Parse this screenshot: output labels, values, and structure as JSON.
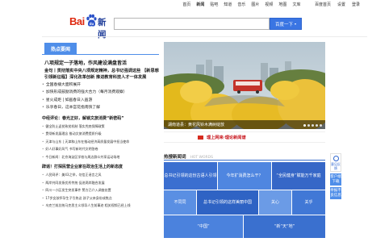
{
  "topnav": {
    "items": [
      "首页",
      "新闻",
      "贴吧",
      "知道",
      "音乐",
      "图片",
      "视频",
      "地图",
      "文库"
    ],
    "active_index": 1,
    "right": [
      "百度首页",
      "设置",
      "登录"
    ]
  },
  "header": {
    "logo_text_left": "Bai",
    "logo_paw_text": "du",
    "logo_text_right": "新闻",
    "search_placeholder": "",
    "search_button": "百度一下",
    "search_caret": "▾"
  },
  "hot_news": {
    "tab_label": "热点要闻",
    "headline_1": "八项规定一子落地，作风建设满盘皆活",
    "headline_2": "金句丨贯彻落实中央八项规定精神，总书记强调这些 【新思想引领新征程】深化改革创新 推进教育科技人才一体发展",
    "items": [
      "全国春播大面积展开",
      "加快形成鼓励消费的强大合力（每月消费观察）",
      "星火成炬 | 如画春日入画游",
      "乐享春日，这本宫花指南快了解"
    ],
    "sub_headline": "中经评论：春光正好，解锁文旅消费“新密码”",
    "sub_items": [
      "健全防止返贫致贫机制 落实兜底保障政策",
      "贯彻新发展理念 推动文旅消费提质升级",
      "天津与山东 | 天津和山东在推动经济高质量发展中担当使命",
      "好人好事好风气 书写新时代文明答卷",
      "今日新闻：北京海淀区学校与周边群众共享运动场地"
    ],
    "sub_headline_2": "辟谣！打探民营企业家在政治生活上的新态度",
    "bottom_items": [
      "人民网评：美43之举，勿信正谣言之风",
      "两岸共同发扬优秀传统 促进两岸融合发展",
      "四川一小区发生突发事件 警方已介入调查处置",
      "17岁女孩怀孕生子引热议 孩子父亲身份成焦点",
      "乌克兰前总统马克思主义领导人生前事迹 相关视频已经上线"
    ]
  },
  "photo": {
    "caption": "湖南道县：黄花风铃木满树绽放",
    "dot_count": 5,
    "active_dot": 0
  },
  "banner": {
    "title": "理上网来·理论新闻谱"
  },
  "hot_words": {
    "title": "热搜新闻词",
    "title_en": "HOT WORDS",
    "tiles": [
      "总书记引领的这份古语人引领",
      "今年扩消费怎么干？",
      "“全民健身”赋能万千家庭",
      "不同同",
      "总书记引领的这样美丽中国",
      "关心",
      "关乎",
      "“中国”",
      "“新”天“地”"
    ]
  },
  "side_tools": {
    "feedback": "意见反馈",
    "app": "客户端下载",
    "share": "举报不良信息"
  },
  "colors": {
    "accent_blue": "#4f8ee9",
    "search_blue": "#3a75e3",
    "logo_red": "#de2910",
    "logo_blue": "#1f3d99",
    "banner_red": "#c8161d"
  }
}
